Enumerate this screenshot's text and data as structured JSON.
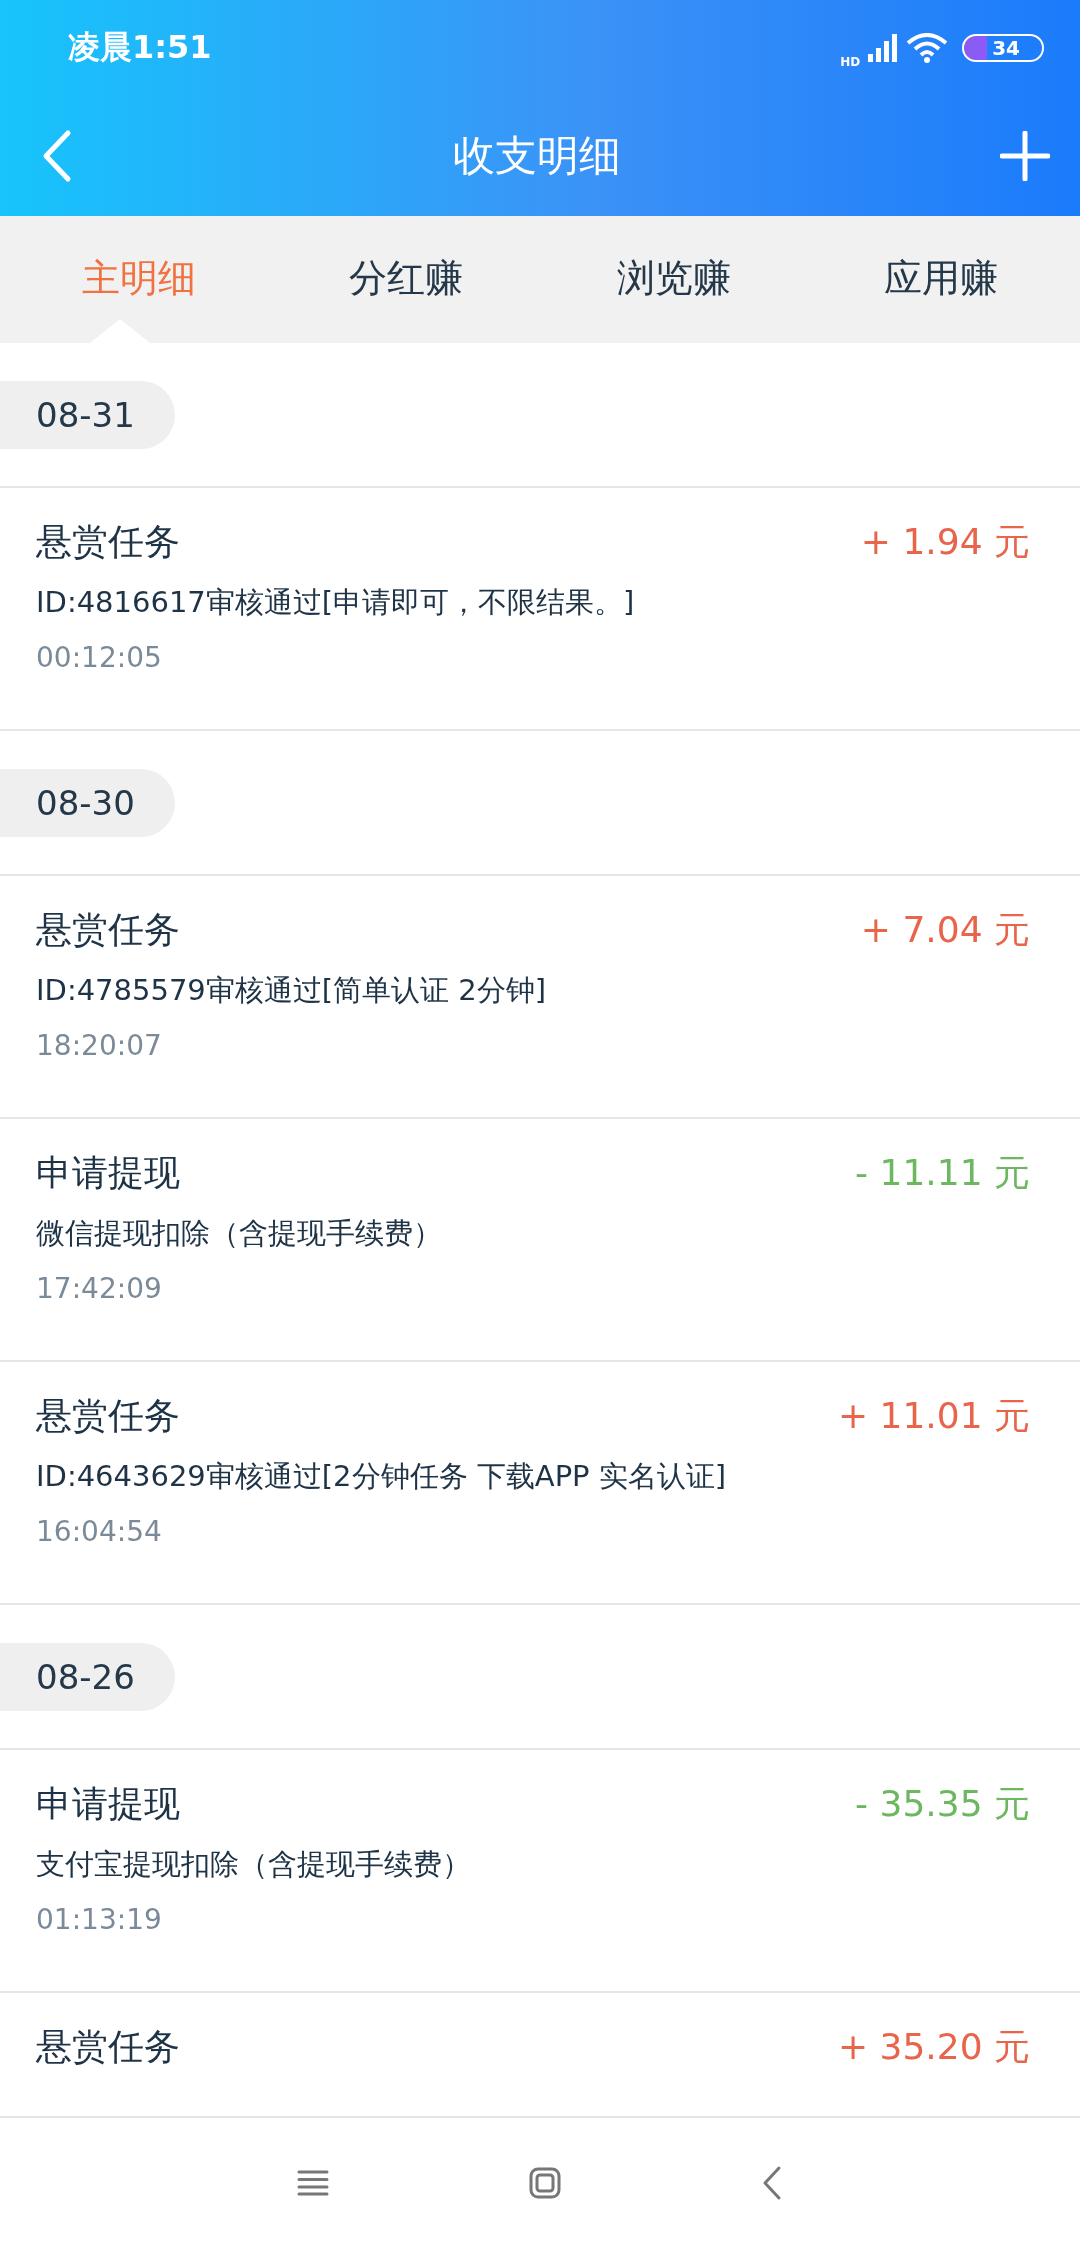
{
  "status_bar": {
    "time": "凌晨1:51",
    "network": "HD",
    "battery": "34"
  },
  "header": {
    "title": "收支明细"
  },
  "tabs": [
    {
      "label": "主明细",
      "selected": true
    },
    {
      "label": "分红赚",
      "selected": false
    },
    {
      "label": "浏览赚",
      "selected": false
    },
    {
      "label": "应用赚",
      "selected": false
    }
  ],
  "groups": [
    {
      "date": "08-31",
      "entries": [
        {
          "title": "悬赏任务",
          "amount": "+ 1.94 元",
          "kind": "income",
          "description": "ID:4816617审核通过[申请即可，不限结果。]",
          "time": "00:12:05"
        }
      ]
    },
    {
      "date": "08-30",
      "entries": [
        {
          "title": "悬赏任务",
          "amount": "+ 7.04 元",
          "kind": "income",
          "description": "ID:4785579审核通过[简单认证 2分钟]",
          "time": "18:20:07"
        },
        {
          "title": "申请提现",
          "amount": "- 11.11 元",
          "kind": "expense",
          "description": "微信提现扣除（含提现手续费）",
          "time": "17:42:09"
        },
        {
          "title": "悬赏任务",
          "amount": "+ 11.01 元",
          "kind": "income",
          "description": "ID:4643629审核通过[2分钟任务 下载APP 实名认证]",
          "time": "16:04:54"
        }
      ]
    },
    {
      "date": "08-26",
      "entries": [
        {
          "title": "申请提现",
          "amount": "- 35.35 元",
          "kind": "expense",
          "description": "支付宝提现扣除（含提现手续费）",
          "time": "01:13:19"
        },
        {
          "title": "悬赏任务",
          "amount": "+ 35.20 元",
          "kind": "income"
        }
      ]
    }
  ]
}
